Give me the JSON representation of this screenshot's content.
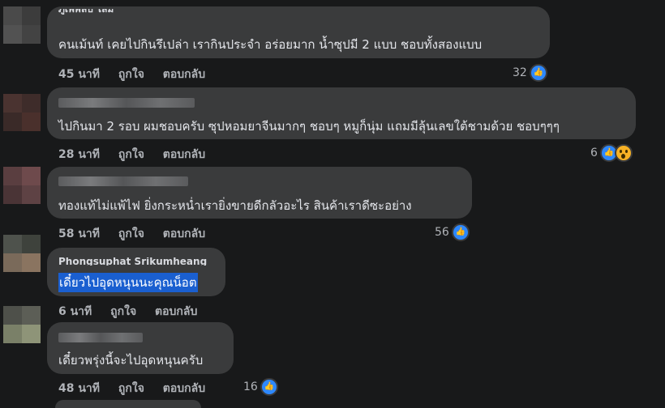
{
  "actions": {
    "like": "ถูกใจ",
    "reply": "ตอบกลับ"
  },
  "colors": {
    "background": "#18191a",
    "bubble": "#3a3b3c",
    "like_blue": "#2d88ff",
    "selection": "#1a5fd0"
  },
  "comments": [
    {
      "author_partial": "ภูเพพลป ไลม",
      "text": "คนเม้นท์ เคยไปกินรึเปล่า เรากินประจำ อร่อยมาก น้ำซุปมี 2 แบบ ชอบทั้งสองแบบ",
      "time": "45 นาที",
      "reaction_count": "32",
      "reactions": [
        "like-icon"
      ]
    },
    {
      "author_partial": "",
      "text": "ไปกินมา 2 รอบ ผมชอบครับ ซุปหอมยาจีนมากๆ ชอบๆ หมูก็นุ่ม แถมมีลุ้นเลขใต้ชามด้วย ชอบๆๆๆ",
      "time": "28 นาที",
      "reaction_count": "6",
      "reactions": [
        "like-icon",
        "wow-icon"
      ]
    },
    {
      "author_partial": "",
      "text": "ทองแท้ไม่แพ้ไฟ ยิ่งกระหน่ำเรายิ่งขายดีกลัวอะไร สินค้าเราดีซะอย่าง",
      "time": "58 นาที",
      "reaction_count": "56",
      "reactions": [
        "like-icon"
      ]
    },
    {
      "author_partial": "Phongsuphat Srikumheang",
      "text": "เดี๋ยวไปอุดหนุนนะคุณน็อต",
      "time": "6 นาที",
      "reaction_count": "",
      "reactions": []
    },
    {
      "author_partial": "",
      "text": "เดี๋ยวพรุ่งนี้จะไปอุดหนุนครับ",
      "time": "48 นาที",
      "reaction_count": "16",
      "reactions": [
        "like-icon"
      ]
    }
  ]
}
